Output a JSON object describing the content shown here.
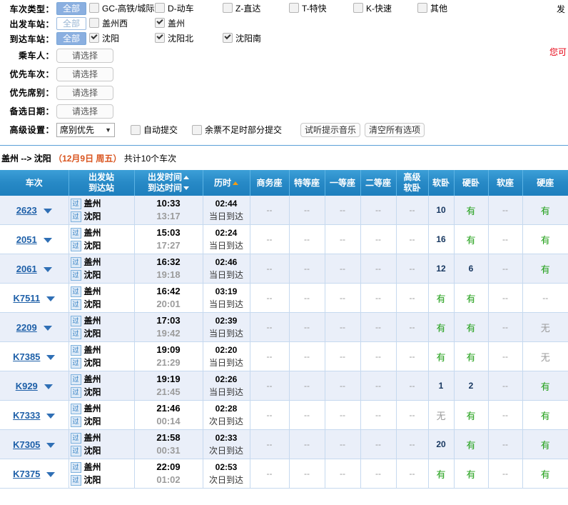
{
  "filters": {
    "rows": [
      {
        "label": "车次类型：",
        "all_label": "全部",
        "all_active": true,
        "options": [
          {
            "label": "GC-高铁/城际",
            "checked": false,
            "slot": "w1"
          },
          {
            "label": "D-动车",
            "checked": false,
            "slot": "w2"
          },
          {
            "label": "Z-直达",
            "checked": false,
            "slot": "w3"
          },
          {
            "label": "T-特快",
            "checked": false,
            "slot": "w4"
          },
          {
            "label": "K-快速",
            "checked": false,
            "slot": "w4"
          },
          {
            "label": "其他",
            "checked": false,
            "slot": "w4"
          }
        ]
      },
      {
        "label": "出发车站：",
        "all_label": "全部",
        "all_active": false,
        "options": [
          {
            "label": "盖州西",
            "checked": false,
            "slot": "w1"
          },
          {
            "label": "盖州",
            "checked": true,
            "slot": "w2"
          }
        ]
      },
      {
        "label": "到达车站：",
        "all_label": "全部",
        "all_active": true,
        "options": [
          {
            "label": "沈阳",
            "checked": true,
            "slot": "w1"
          },
          {
            "label": "沈阳北",
            "checked": true,
            "slot": "w2"
          },
          {
            "label": "沈阳南",
            "checked": true,
            "slot": "w3"
          }
        ]
      }
    ],
    "selects": [
      {
        "label": "乘车人：",
        "value": "请选择"
      },
      {
        "label": "优先车次：",
        "value": "请选择"
      },
      {
        "label": "优先席别：",
        "value": "请选择"
      },
      {
        "label": "备选日期：",
        "value": "请选择"
      }
    ],
    "advanced": {
      "label": "高级设置：",
      "dropdown_value": "席别优先",
      "auto_submit_label": "自动提交",
      "auto_submit_checked": false,
      "partial_submit_label": "余票不足时部分提交",
      "partial_submit_checked": false,
      "preview_music_label": "试听提示音乐",
      "clear_all_label": "清空所有选项"
    },
    "top_right_text": "发",
    "right_note": "您可"
  },
  "results": {
    "from": "盖州",
    "arrow": "-->",
    "to": "沈阳",
    "date": "（12月9日  周五）",
    "count_text": "共计10个车次"
  },
  "table": {
    "headers": {
      "train_no": "车次",
      "station_dep": "出发站",
      "station_arr": "到达站",
      "time_dep": "出发时间",
      "time_arr": "到达时间",
      "duration": "历时",
      "business": "商务座",
      "special": "特等座",
      "first": "一等座",
      "second": "二等座",
      "premium_soft_sleeper_l1": "高级",
      "premium_soft_sleeper_l2": "软卧",
      "soft_sleeper": "软卧",
      "hard_sleeper": "硬卧",
      "soft_seat": "软座",
      "hard_seat": "硬座"
    },
    "pass_icon": "过",
    "rows": [
      {
        "train_no": "2623",
        "dep_station": "盖州",
        "arr_station": "沈阳",
        "dep_time": "10:33",
        "arr_time": "13:17",
        "duration": "02:44",
        "day_note": "当日到达",
        "seats": [
          "--",
          "--",
          "--",
          "--",
          "--",
          "10",
          "有",
          "--",
          "有"
        ]
      },
      {
        "train_no": "2051",
        "dep_station": "盖州",
        "arr_station": "沈阳",
        "dep_time": "15:03",
        "arr_time": "17:27",
        "duration": "02:24",
        "day_note": "当日到达",
        "seats": [
          "--",
          "--",
          "--",
          "--",
          "--",
          "16",
          "有",
          "--",
          "有"
        ]
      },
      {
        "train_no": "2061",
        "dep_station": "盖州",
        "arr_station": "沈阳",
        "dep_time": "16:32",
        "arr_time": "19:18",
        "duration": "02:46",
        "day_note": "当日到达",
        "seats": [
          "--",
          "--",
          "--",
          "--",
          "--",
          "12",
          "6",
          "--",
          "有"
        ]
      },
      {
        "train_no": "K7511",
        "dep_station": "盖州",
        "arr_station": "沈阳",
        "dep_time": "16:42",
        "arr_time": "20:01",
        "duration": "03:19",
        "day_note": "当日到达",
        "seats": [
          "--",
          "--",
          "--",
          "--",
          "--",
          "有",
          "有",
          "--",
          "--"
        ]
      },
      {
        "train_no": "2209",
        "dep_station": "盖州",
        "arr_station": "沈阳",
        "dep_time": "17:03",
        "arr_time": "19:42",
        "duration": "02:39",
        "day_note": "当日到达",
        "seats": [
          "--",
          "--",
          "--",
          "--",
          "--",
          "有",
          "有",
          "--",
          "无"
        ]
      },
      {
        "train_no": "K7385",
        "dep_station": "盖州",
        "arr_station": "沈阳",
        "dep_time": "19:09",
        "arr_time": "21:29",
        "duration": "02:20",
        "day_note": "当日到达",
        "seats": [
          "--",
          "--",
          "--",
          "--",
          "--",
          "有",
          "有",
          "--",
          "无"
        ]
      },
      {
        "train_no": "K929",
        "dep_station": "盖州",
        "arr_station": "沈阳",
        "dep_time": "19:19",
        "arr_time": "21:45",
        "duration": "02:26",
        "day_note": "当日到达",
        "seats": [
          "--",
          "--",
          "--",
          "--",
          "--",
          "1",
          "2",
          "--",
          "有"
        ]
      },
      {
        "train_no": "K7333",
        "dep_station": "盖州",
        "arr_station": "沈阳",
        "dep_time": "21:46",
        "arr_time": "00:14",
        "duration": "02:28",
        "day_note": "次日到达",
        "seats": [
          "--",
          "--",
          "--",
          "--",
          "--",
          "无",
          "有",
          "--",
          "有"
        ]
      },
      {
        "train_no": "K7305",
        "dep_station": "盖州",
        "arr_station": "沈阳",
        "dep_time": "21:58",
        "arr_time": "00:31",
        "duration": "02:33",
        "day_note": "次日到达",
        "seats": [
          "--",
          "--",
          "--",
          "--",
          "--",
          "20",
          "有",
          "--",
          "有"
        ]
      },
      {
        "train_no": "K7375",
        "dep_station": "盖州",
        "arr_station": "沈阳",
        "dep_time": "22:09",
        "arr_time": "01:02",
        "duration": "02:53",
        "day_note": "次日到达",
        "seats": [
          "--",
          "--",
          "--",
          "--",
          "--",
          "有",
          "有",
          "--",
          "有"
        ]
      }
    ]
  },
  "colors": {
    "header_blue": "#2789c6",
    "link_blue": "#1d5fa8",
    "available_green": "#22a019",
    "unavailable_gray": "#9b9b9b",
    "accent_red": "#e60012",
    "date_orange": "#d9541e"
  }
}
